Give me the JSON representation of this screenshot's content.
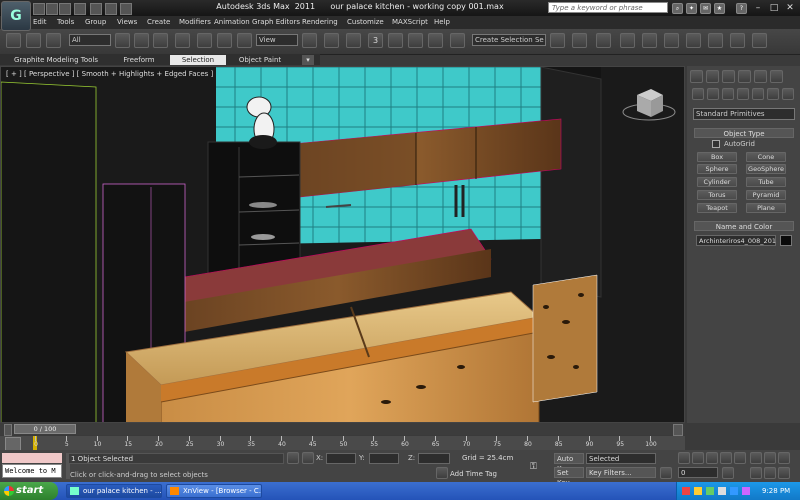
{
  "app": {
    "logo": "G",
    "title": "Autodesk 3ds Max  2011      our palace kitchen - working copy 001.max"
  },
  "search": {
    "placeholder": "Type a keyword or phrase"
  },
  "menu": [
    "Edit",
    "Tools",
    "Group",
    "Views",
    "Create",
    "Modifiers",
    "Animation",
    "Graph Editors",
    "Rendering",
    "Customize",
    "MAXScript",
    "Help"
  ],
  "toolbar": {
    "filter_dropdown": "All",
    "view_dropdown": "View",
    "snap_label": "3",
    "selection_set": "Create Selection Se"
  },
  "ribbon": {
    "tabs": [
      "Graphite Modeling Tools",
      "Freeform",
      "Selection",
      "Object Paint"
    ]
  },
  "viewport": {
    "label": "[ + ] [ Perspective ] [ Smooth + Highlights + Edged Faces ]"
  },
  "command_panel": {
    "category_dropdown": "Standard Primitives",
    "object_type_header": "Object Type",
    "autogrid_label": "AutoGrid",
    "buttons": [
      "Box",
      "Cone",
      "Sphere",
      "GeoSphere",
      "Cylinder",
      "Tube",
      "Torus",
      "Pyramid",
      "Teapot",
      "Plane"
    ],
    "name_color_header": "Name and Color",
    "object_name": "Archinteriros4_008_201"
  },
  "timeline": {
    "frame_counter": "0 / 100",
    "ticks": [
      "0",
      "5",
      "10",
      "15",
      "20",
      "25",
      "30",
      "35",
      "40",
      "45",
      "50",
      "55",
      "60",
      "65",
      "70",
      "75",
      "80",
      "85",
      "90",
      "95",
      "100"
    ]
  },
  "status": {
    "maxscript_text": "Welcome to M",
    "selection_status": "1 Object Selected",
    "prompt": "Click or click-and-drag to select objects",
    "x_label": "X:",
    "y_label": "Y:",
    "z_label": "Z:",
    "grid": "Grid = 25.4cm",
    "add_time_tag": "Add Time Tag",
    "auto_key": "Auto Key",
    "set_key": "Set Key",
    "selected_dropdown": "Selected",
    "key_filters": "Key Filters...",
    "frame_field": "0"
  },
  "taskbar": {
    "start": "start",
    "tasks": [
      "our palace kitchen - ...",
      "XnView - [Browser - C..."
    ],
    "clock": "9:28 PM"
  },
  "colors": {
    "cyan_wall": "#3fc9c9",
    "wood_dark": "#5a3a1c",
    "wood_light": "#d8b070",
    "taskbar": "#2453b8"
  }
}
